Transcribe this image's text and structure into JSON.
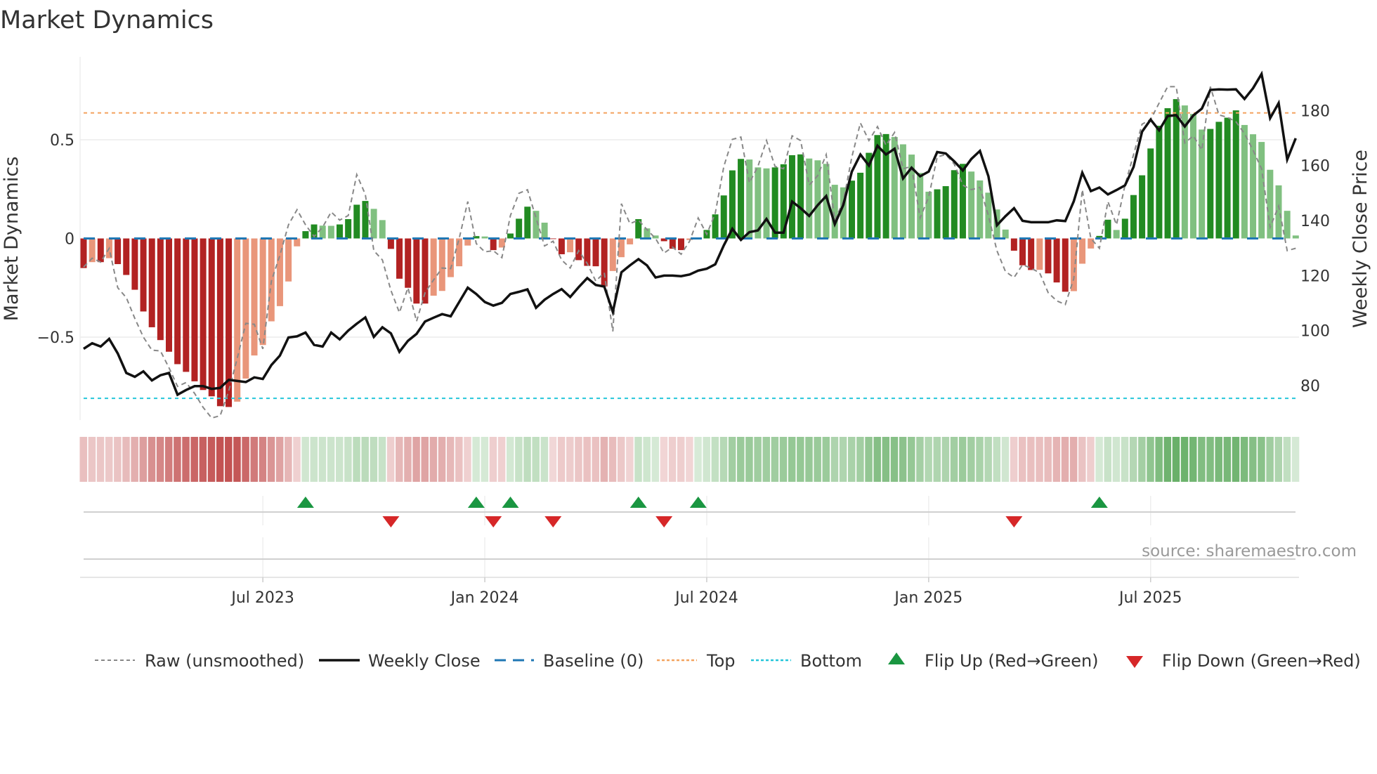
{
  "title": "Market Dynamics",
  "source": "source: sharemaestro.com",
  "colors": {
    "strong_red": "#b22222",
    "weak_red": "#e9967a",
    "strong_green": "#228b22",
    "weak_green": "#80c080",
    "close": "#111111",
    "raw": "#888888",
    "baseline": "#1f77b4",
    "top": "#f4a460",
    "bottom": "#26c6da",
    "flip_up": "#1a9641",
    "flip_down": "#d62728"
  },
  "legend": {
    "raw": "Raw (unsmoothed)",
    "close": "Weekly Close",
    "baseline": "Baseline (0)",
    "top": "Top",
    "bottom": "Bottom",
    "flip_up": "Flip Up (Red→Green)",
    "flip_down": "Flip Down (Green→Red)"
  },
  "chart_data": {
    "type": "bar",
    "title": "Market Dynamics",
    "ylabel": "Market Dynamics",
    "y2label": "Weekly Close Price",
    "ylim": [
      -0.92,
      0.92
    ],
    "y2lim": [
      67.5,
      199.5
    ],
    "yticks": [
      {
        "value": 0.5,
        "label": "0.5"
      },
      {
        "value": 0,
        "label": "0"
      },
      {
        "value": -0.5,
        "label": "−0.5"
      }
    ],
    "y2ticks": [
      {
        "value": 180,
        "label": "180"
      },
      {
        "value": 160,
        "label": "160"
      },
      {
        "value": 140,
        "label": "140"
      },
      {
        "value": 120,
        "label": "120"
      },
      {
        "value": 100,
        "label": "100"
      },
      {
        "value": 80,
        "label": "80"
      }
    ],
    "x_ticks": [
      {
        "label": "Jul 2023",
        "week": 21
      },
      {
        "label": "Jan 2024",
        "week": 47
      },
      {
        "label": "Jul 2024",
        "week": 73
      },
      {
        "label": "Jan 2025",
        "week": 99
      },
      {
        "label": "Jul 2025",
        "week": 125
      }
    ],
    "top_level": 0.636,
    "bottom_level": -0.81,
    "baseline": 0,
    "smoothed": [
      -0.15,
      -0.12,
      -0.12,
      -0.1,
      -0.13,
      -0.185,
      -0.26,
      -0.37,
      -0.45,
      -0.515,
      -0.574,
      -0.637,
      -0.676,
      -0.724,
      -0.768,
      -0.8,
      -0.85,
      -0.854,
      -0.827,
      -0.71,
      -0.593,
      -0.54,
      -0.42,
      -0.343,
      -0.218,
      -0.04,
      0.037,
      0.071,
      0.065,
      0.064,
      0.071,
      0.098,
      0.171,
      0.19,
      0.15,
      0.093,
      -0.053,
      -0.204,
      -0.25,
      -0.33,
      -0.33,
      -0.29,
      -0.266,
      -0.196,
      -0.141,
      -0.036,
      0.012,
      0.01,
      -0.059,
      -0.046,
      0.025,
      0.1,
      0.161,
      0.14,
      0.08,
      -0.003,
      -0.08,
      -0.07,
      -0.11,
      -0.139,
      -0.141,
      -0.243,
      -0.165,
      -0.095,
      -0.03,
      0.098,
      0.051,
      0.015,
      -0.014,
      -0.052,
      -0.059,
      -0.008,
      0.002,
      0.043,
      0.122,
      0.218,
      0.345,
      0.403,
      0.4,
      0.36,
      0.355,
      0.36,
      0.376,
      0.422,
      0.426,
      0.405,
      0.396,
      0.378,
      0.272,
      0.259,
      0.293,
      0.333,
      0.434,
      0.524,
      0.529,
      0.514,
      0.477,
      0.425,
      0.332,
      0.237,
      0.249,
      0.265,
      0.346,
      0.378,
      0.339,
      0.294,
      0.232,
      0.147,
      0.045,
      -0.062,
      -0.136,
      -0.16,
      -0.159,
      -0.177,
      -0.223,
      -0.27,
      -0.267,
      -0.128,
      -0.051,
      0.013,
      0.095,
      0.043,
      0.1,
      0.22,
      0.32,
      0.456,
      0.571,
      0.66,
      0.706,
      0.674,
      0.631,
      0.552,
      0.555,
      0.591,
      0.612,
      0.649,
      0.575,
      0.528,
      0.489,
      0.348,
      0.269,
      0.14,
      0.015
    ],
    "raw": [
      -0.145,
      -0.1,
      -0.12,
      -0.05,
      -0.25,
      -0.3,
      -0.405,
      -0.5,
      -0.566,
      -0.57,
      -0.655,
      -0.75,
      -0.73,
      -0.785,
      -0.856,
      -0.91,
      -0.898,
      -0.773,
      -0.607,
      -0.43,
      -0.435,
      -0.56,
      -0.216,
      -0.085,
      0.069,
      0.146,
      0.069,
      0.01,
      0.057,
      0.134,
      0.093,
      0.116,
      0.324,
      0.223,
      -0.062,
      -0.109,
      -0.263,
      -0.376,
      -0.25,
      -0.42,
      -0.275,
      -0.21,
      -0.15,
      -0.153,
      0,
      0.187,
      -0.026,
      -0.068,
      -0.062,
      -0.097,
      0.116,
      0.229,
      0.247,
      0.104,
      -0.038,
      -0.014,
      -0.109,
      -0.15,
      -0.062,
      -0.127,
      -0.216,
      -0.174,
      -0.471,
      0.176,
      0.075,
      0.093,
      0.045,
      0,
      -0.074,
      -0.044,
      -0.08,
      -0.014,
      0.104,
      0.021,
      0.128,
      0.365,
      0.502,
      0.514,
      0.282,
      0.365,
      0.496,
      0.365,
      0.353,
      0.52,
      0.496,
      0.27,
      0.318,
      0.425,
      0.093,
      0.187,
      0.413,
      0.585,
      0.496,
      0.567,
      0.472,
      0.537,
      0.353,
      0.365,
      0.104,
      0.211,
      0.413,
      0.425,
      0.377,
      0.27,
      0.247,
      0.259,
      0.116,
      -0.062,
      -0.168,
      -0.198,
      -0.133,
      -0.151,
      -0.174,
      -0.275,
      -0.316,
      -0.335,
      -0.204,
      0.247,
      0,
      -0.05,
      0.187,
      0.069,
      0.27,
      0.425,
      0.579,
      0.603,
      0.686,
      0.769,
      0.769,
      0.484,
      0.52,
      0.448,
      0.769,
      0.626,
      0.614,
      0.591,
      0.531,
      0.448,
      0.353,
      0.057,
      0.164,
      -0.062,
      -0.05
    ],
    "weekly_close": [
      93.4,
      95.4,
      94.2,
      97,
      91.7,
      84.6,
      83.2,
      85.2,
      81.9,
      83.8,
      84.6,
      76.7,
      78.4,
      79.8,
      79.8,
      78.8,
      79.2,
      82.1,
      81.7,
      81.3,
      83,
      82.4,
      87.5,
      90.9,
      97.5,
      97.9,
      99.3,
      94.8,
      94.2,
      99.3,
      96.8,
      100,
      102.5,
      104.8,
      97.7,
      101.2,
      99,
      92.3,
      96.3,
      98.8,
      103.3,
      104.7,
      106,
      105.2,
      110.4,
      115.6,
      113.3,
      110.4,
      109.1,
      110.1,
      113.3,
      114.1,
      115,
      108.3,
      111.2,
      113.3,
      115.1,
      112.2,
      115.8,
      119.1,
      116.6,
      116,
      106.8,
      121.2,
      123.7,
      126,
      123.7,
      119.3,
      120,
      120,
      119.8,
      120.4,
      121.8,
      122.5,
      124.1,
      131,
      137,
      133,
      135.8,
      136.4,
      140.6,
      135.6,
      135.6,
      146.9,
      144.5,
      141.7,
      145.6,
      148.9,
      138.7,
      145.7,
      157.8,
      164,
      160,
      167.2,
      164,
      166.1,
      155.3,
      159.2,
      156.1,
      157.8,
      164.9,
      164.4,
      161.5,
      158.2,
      162.4,
      165.3,
      156.1,
      138.3,
      141.6,
      144.5,
      139.9,
      139.4,
      139.4,
      139.4,
      140.1,
      139.8,
      147,
      157.4,
      150.7,
      152,
      149.5,
      151.1,
      152.8,
      159.5,
      172.3,
      176.7,
      172.8,
      178,
      178.3,
      174.2,
      178.2,
      180.7,
      187.5,
      187.7,
      187.6,
      187.7,
      184.2,
      188.1,
      193.3,
      177.2,
      182.7,
      162.2,
      169.9
    ],
    "flip_up_weeks": [
      26,
      46,
      50,
      65,
      72,
      119
    ],
    "flip_down_weeks": [
      36,
      48,
      55,
      68,
      109
    ]
  }
}
